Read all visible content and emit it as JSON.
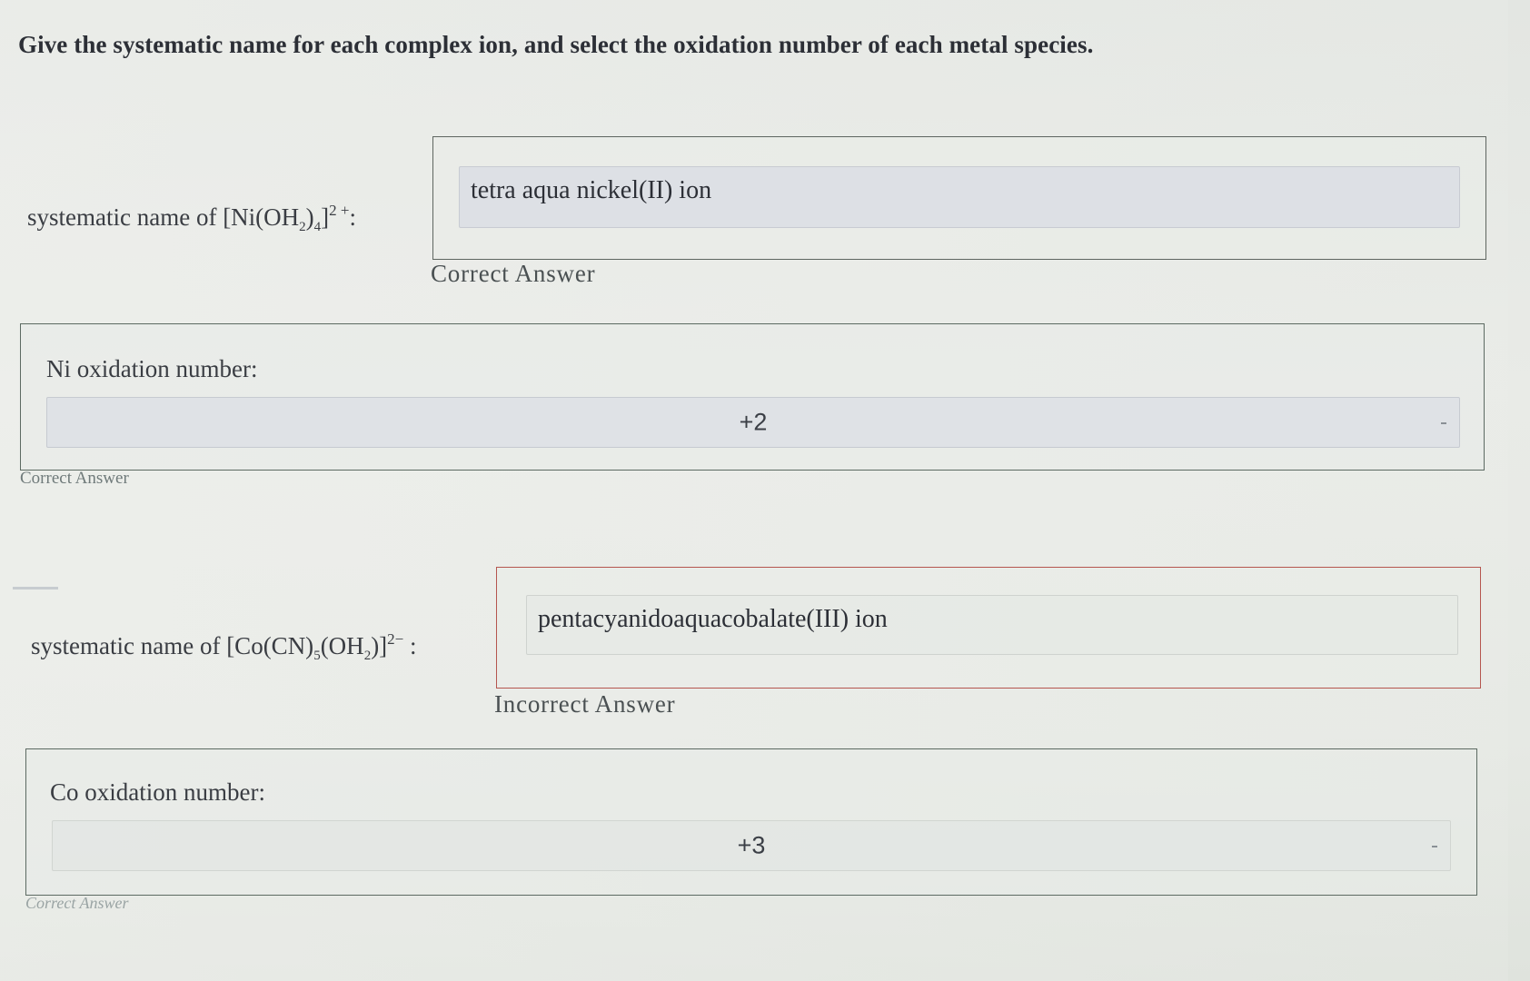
{
  "instructions": "Give the systematic name for each complex ion, and select the oxidation number of each metal species.",
  "question1": {
    "label_prefix": "systematic name of ",
    "formula_open": "[Ni(OH",
    "formula_sub1": "2",
    "formula_mid": ")",
    "formula_sub2": "4",
    "formula_close": "]",
    "formula_charge": "2 +",
    "label_suffix": ":",
    "answer": "tetra aqua nickel(II) ion",
    "feedback": "Correct Answer"
  },
  "question2": {
    "label": "Ni oxidation number:",
    "selected": "+2",
    "feedback": "Correct Answer"
  },
  "question3": {
    "label_prefix": "systematic name of ",
    "formula_open": "[Co(CN)",
    "formula_sub1": "5",
    "formula_mid": "(OH",
    "formula_sub2": "2",
    "formula_close": ")]",
    "formula_charge": "2−",
    "label_suffix": " :",
    "answer": "pentacyanidoaquacobalate(III) ion",
    "feedback": "Incorrect Answer"
  },
  "question4": {
    "label": "Co oxidation number:",
    "selected": "+3",
    "feedback": "Correct Answer"
  },
  "colors": {
    "correct_border": "#5e6560",
    "incorrect_border": "#b5564f",
    "input_fill": "#dde0e5"
  }
}
